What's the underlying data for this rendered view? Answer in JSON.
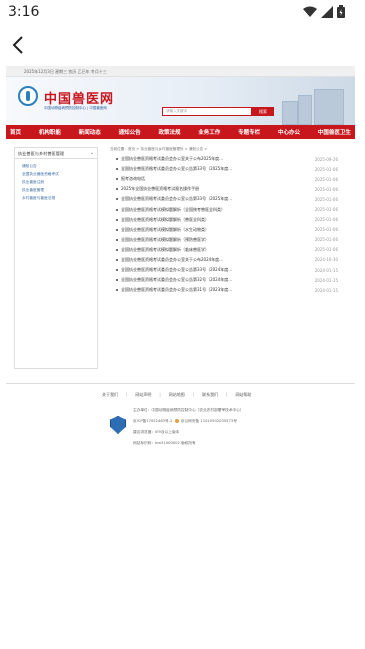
{
  "status": {
    "time": "3:16"
  },
  "page": {
    "top_strip": "2025年12月3日 星期三 农历 乙巳年 冬月十三",
    "logo_title": "中国兽医网",
    "logo_sub": "中国动物疫病预防控制中心 | 中国兽医网",
    "search_placeholder": "请输入关键字",
    "search_button": "搜索",
    "nav": [
      "首页",
      "机构职能",
      "新闻动态",
      "通知公告",
      "政策法规",
      "业务工作",
      "专题专栏",
      "中心办公",
      "中国兽医卫生"
    ],
    "breadcrumb": "当前位置：首页 > 执业兽医与乡村兽医管理处 > 通知公告 >",
    "sidebar": {
      "title": "执业兽医与乡村兽医管理",
      "items": [
        "通知公告",
        "全国执业兽医资格考试",
        "执业兽医注册",
        "执业兽医管理",
        "乡村兽医与兽医法规"
      ]
    },
    "notices": [
      {
        "title": "全国执业兽医资格考试委员会办公室关于公布2025年度...",
        "date": "2025-09-26"
      },
      {
        "title": "全国执业兽医资格考试委员会办公室公告第33号（2025年度...",
        "date": "2025-01-06"
      },
      {
        "title": "报考咨询电话",
        "date": "2025-01-06"
      },
      {
        "title": "2025年全国执业兽医资格考试报名操作手册",
        "date": "2025-01-06"
      },
      {
        "title": "全国执业兽医资格考试委员会办公室公告第33号（2025年度...",
        "date": "2025-01-06"
      },
      {
        "title": "全国执业兽医资格考试模拟题解析（全国统考兽医全科类）",
        "date": "2025-01-06"
      },
      {
        "title": "全国执业兽医资格考试模拟题解析（兽医全科类）",
        "date": "2025-01-06"
      },
      {
        "title": "全国执业兽医资格考试模拟题解析（水生动物类）",
        "date": "2025-01-06"
      },
      {
        "title": "全国执业兽医资格考试模拟题解析（预防兽医学）",
        "date": "2025-01-06"
      },
      {
        "title": "全国执业兽医资格考试模拟题解析（临床兽医学）",
        "date": "2025-01-06"
      },
      {
        "title": "全国执业兽医资格考试委员会办公室关于公布2024年度...",
        "date": "2024-10-30"
      },
      {
        "title": "全国执业兽医资格考试委员会办公室公告第33号（2024年度...",
        "date": "2024-01-15"
      },
      {
        "title": "全国执业兽医资格考试委员会办公室公告第32号（2024年度...",
        "date": "2024-01-15"
      },
      {
        "title": "全国执业兽医资格考试委员会办公室公告第31号（2023年度...",
        "date": "2024-01-15"
      }
    ],
    "footer": {
      "links": [
        "关于我们",
        "网站声明",
        "网站地图",
        "联系我们",
        "网站帮助"
      ],
      "info": [
        "主办单位：中国动物疫病预防控制中心（农业农村部屠宰技术中心）",
        "京ICP备17052463号-2",
        "京公网安备 11010502035573号",
        "建议浏览器：IE9及以上版本",
        "网站标识码：bm31000002 版权所有"
      ]
    }
  }
}
